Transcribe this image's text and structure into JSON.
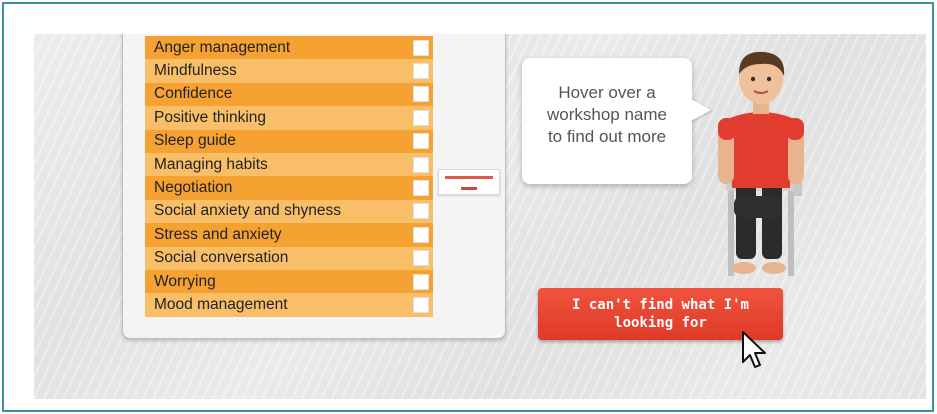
{
  "workshops": [
    {
      "label": "Anger management",
      "style": "dark"
    },
    {
      "label": "Mindfulness",
      "style": "light"
    },
    {
      "label": "Confidence",
      "style": "dark"
    },
    {
      "label": "Positive thinking",
      "style": "light"
    },
    {
      "label": "Sleep guide",
      "style": "dark"
    },
    {
      "label": "Managing habits",
      "style": "light"
    },
    {
      "label": "Negotiation",
      "style": "dark"
    },
    {
      "label": "Social anxiety and shyness",
      "style": "light"
    },
    {
      "label": "Stress and anxiety",
      "style": "dark"
    },
    {
      "label": "Social conversation",
      "style": "light"
    },
    {
      "label": "Worrying",
      "style": "dark"
    },
    {
      "label": "Mood management",
      "style": "light"
    }
  ],
  "bubble": {
    "line1": "Hover over a",
    "line2": "workshop name",
    "line3": "to find out more"
  },
  "cta": {
    "line1": "I can't find what I'm",
    "line2": "looking for"
  },
  "colors": {
    "row_dark": "#f5a233",
    "row_light": "#f8bf68",
    "cta": "#e8432f",
    "frame": "#3a8fa3"
  },
  "icons": {
    "cursor": "arrow-cursor-icon",
    "avatar": "seated-person-illustration"
  }
}
